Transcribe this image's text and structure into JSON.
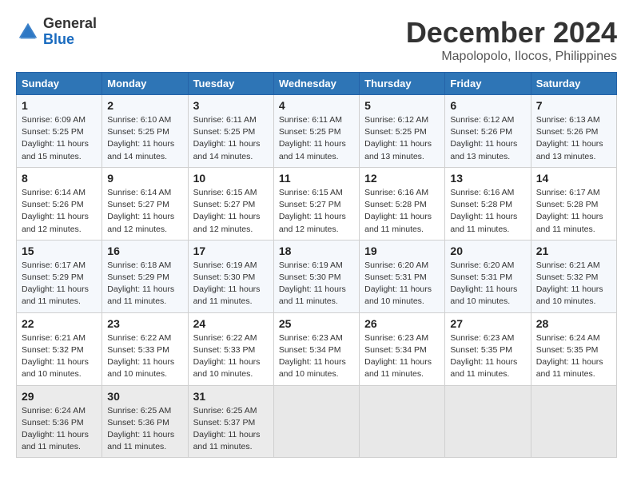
{
  "header": {
    "logo_general": "General",
    "logo_blue": "Blue",
    "month_year": "December 2024",
    "location": "Mapolopolo, Ilocos, Philippines"
  },
  "columns": [
    "Sunday",
    "Monday",
    "Tuesday",
    "Wednesday",
    "Thursday",
    "Friday",
    "Saturday"
  ],
  "weeks": [
    [
      {
        "day": "1",
        "sunrise": "6:09 AM",
        "sunset": "5:25 PM",
        "daylight": "11 hours and 15 minutes."
      },
      {
        "day": "2",
        "sunrise": "6:10 AM",
        "sunset": "5:25 PM",
        "daylight": "11 hours and 14 minutes."
      },
      {
        "day": "3",
        "sunrise": "6:11 AM",
        "sunset": "5:25 PM",
        "daylight": "11 hours and 14 minutes."
      },
      {
        "day": "4",
        "sunrise": "6:11 AM",
        "sunset": "5:25 PM",
        "daylight": "11 hours and 14 minutes."
      },
      {
        "day": "5",
        "sunrise": "6:12 AM",
        "sunset": "5:25 PM",
        "daylight": "11 hours and 13 minutes."
      },
      {
        "day": "6",
        "sunrise": "6:12 AM",
        "sunset": "5:26 PM",
        "daylight": "11 hours and 13 minutes."
      },
      {
        "day": "7",
        "sunrise": "6:13 AM",
        "sunset": "5:26 PM",
        "daylight": "11 hours and 13 minutes."
      }
    ],
    [
      {
        "day": "8",
        "sunrise": "6:14 AM",
        "sunset": "5:26 PM",
        "daylight": "11 hours and 12 minutes."
      },
      {
        "day": "9",
        "sunrise": "6:14 AM",
        "sunset": "5:27 PM",
        "daylight": "11 hours and 12 minutes."
      },
      {
        "day": "10",
        "sunrise": "6:15 AM",
        "sunset": "5:27 PM",
        "daylight": "11 hours and 12 minutes."
      },
      {
        "day": "11",
        "sunrise": "6:15 AM",
        "sunset": "5:27 PM",
        "daylight": "11 hours and 12 minutes."
      },
      {
        "day": "12",
        "sunrise": "6:16 AM",
        "sunset": "5:28 PM",
        "daylight": "11 hours and 11 minutes."
      },
      {
        "day": "13",
        "sunrise": "6:16 AM",
        "sunset": "5:28 PM",
        "daylight": "11 hours and 11 minutes."
      },
      {
        "day": "14",
        "sunrise": "6:17 AM",
        "sunset": "5:28 PM",
        "daylight": "11 hours and 11 minutes."
      }
    ],
    [
      {
        "day": "15",
        "sunrise": "6:17 AM",
        "sunset": "5:29 PM",
        "daylight": "11 hours and 11 minutes."
      },
      {
        "day": "16",
        "sunrise": "6:18 AM",
        "sunset": "5:29 PM",
        "daylight": "11 hours and 11 minutes."
      },
      {
        "day": "17",
        "sunrise": "6:19 AM",
        "sunset": "5:30 PM",
        "daylight": "11 hours and 11 minutes."
      },
      {
        "day": "18",
        "sunrise": "6:19 AM",
        "sunset": "5:30 PM",
        "daylight": "11 hours and 11 minutes."
      },
      {
        "day": "19",
        "sunrise": "6:20 AM",
        "sunset": "5:31 PM",
        "daylight": "11 hours and 10 minutes."
      },
      {
        "day": "20",
        "sunrise": "6:20 AM",
        "sunset": "5:31 PM",
        "daylight": "11 hours and 10 minutes."
      },
      {
        "day": "21",
        "sunrise": "6:21 AM",
        "sunset": "5:32 PM",
        "daylight": "11 hours and 10 minutes."
      }
    ],
    [
      {
        "day": "22",
        "sunrise": "6:21 AM",
        "sunset": "5:32 PM",
        "daylight": "11 hours and 10 minutes."
      },
      {
        "day": "23",
        "sunrise": "6:22 AM",
        "sunset": "5:33 PM",
        "daylight": "11 hours and 10 minutes."
      },
      {
        "day": "24",
        "sunrise": "6:22 AM",
        "sunset": "5:33 PM",
        "daylight": "11 hours and 10 minutes."
      },
      {
        "day": "25",
        "sunrise": "6:23 AM",
        "sunset": "5:34 PM",
        "daylight": "11 hours and 10 minutes."
      },
      {
        "day": "26",
        "sunrise": "6:23 AM",
        "sunset": "5:34 PM",
        "daylight": "11 hours and 11 minutes."
      },
      {
        "day": "27",
        "sunrise": "6:23 AM",
        "sunset": "5:35 PM",
        "daylight": "11 hours and 11 minutes."
      },
      {
        "day": "28",
        "sunrise": "6:24 AM",
        "sunset": "5:35 PM",
        "daylight": "11 hours and 11 minutes."
      }
    ],
    [
      {
        "day": "29",
        "sunrise": "6:24 AM",
        "sunset": "5:36 PM",
        "daylight": "11 hours and 11 minutes."
      },
      {
        "day": "30",
        "sunrise": "6:25 AM",
        "sunset": "5:36 PM",
        "daylight": "11 hours and 11 minutes."
      },
      {
        "day": "31",
        "sunrise": "6:25 AM",
        "sunset": "5:37 PM",
        "daylight": "11 hours and 11 minutes."
      },
      null,
      null,
      null,
      null
    ]
  ]
}
